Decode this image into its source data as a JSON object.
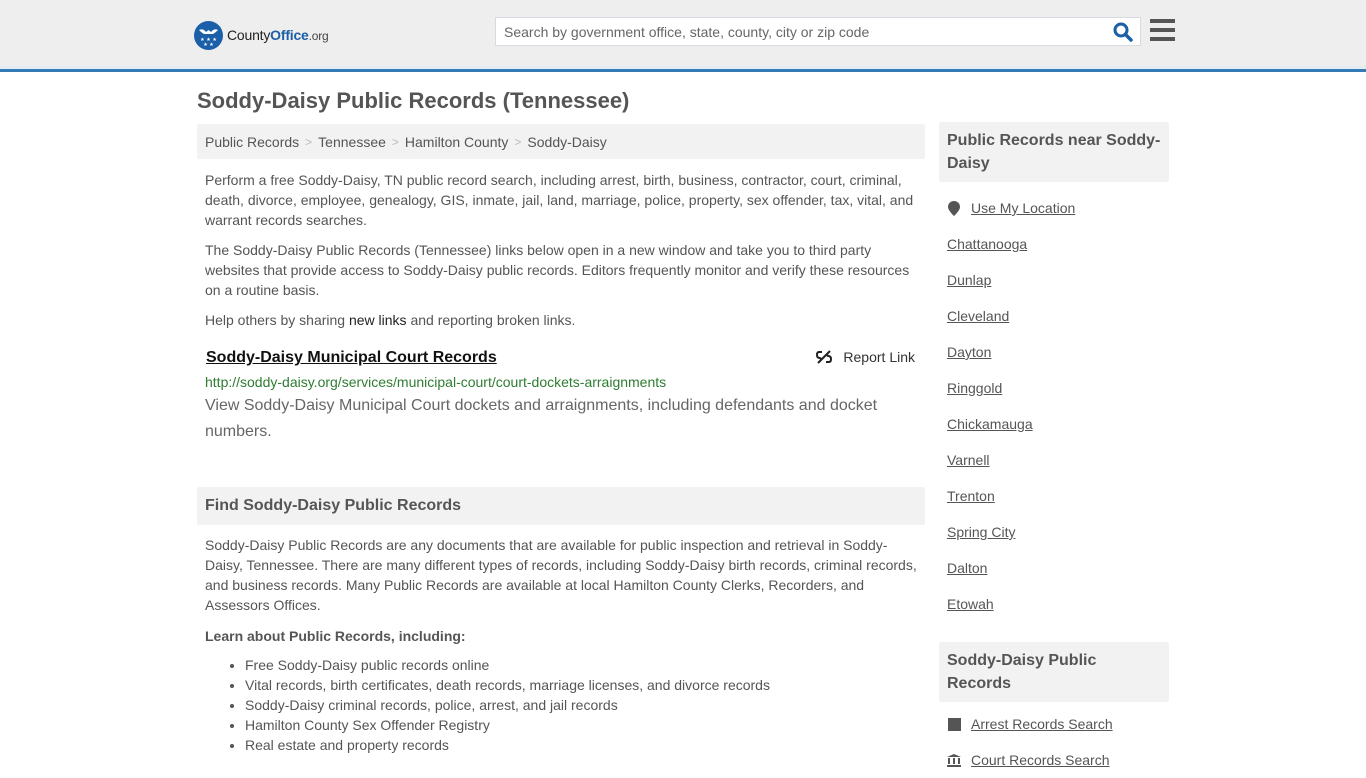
{
  "header": {
    "logo": {
      "name_part1": "County",
      "name_part2": "Office",
      "tld": ".org"
    },
    "search": {
      "placeholder": "Search by government office, state, county, city or zip code",
      "value": ""
    },
    "search_icon": "search-icon",
    "menu_icon": "hamburger-menu-icon"
  },
  "page": {
    "title": "Soddy-Daisy Public Records (Tennessee)",
    "breadcrumb": [
      "Public Records",
      "Tennessee",
      "Hamilton County",
      "Soddy-Daisy"
    ],
    "intro": [
      "Perform a free Soddy-Daisy, TN public record search, including arrest, birth, business, contractor, court, criminal, death, divorce, employee, genealogy, GIS, inmate, jail, land, marriage, police, property, sex offender, tax, vital, and warrant records searches.",
      "The Soddy-Daisy Public Records (Tennessee) links below open in a new window and take you to third party websites that provide access to Soddy-Daisy public records. Editors frequently monitor and verify these resources on a routine basis."
    ],
    "help": {
      "before": "Help others by sharing ",
      "link": "new links",
      "after": " and reporting broken links."
    },
    "listing": {
      "title": "Soddy-Daisy Municipal Court Records",
      "report_label": "Report Link",
      "url": "http://soddy-daisy.org/services/municipal-court/court-dockets-arraignments",
      "description": "View Soddy-Daisy Municipal Court dockets and arraignments, including defendants and docket numbers."
    },
    "find_section": {
      "heading": "Find Soddy-Daisy Public Records",
      "body": "Soddy-Daisy Public Records are any documents that are available for public inspection and retrieval in Soddy-Daisy, Tennessee. There are many different types of records, including Soddy-Daisy birth records, criminal records, and business records. Many Public Records are available at local Hamilton County Clerks, Recorders, and Assessors Offices.",
      "subheading": "Learn about Public Records, including:",
      "bullets": [
        "Free Soddy-Daisy public records online",
        "Vital records, birth certificates, death records, marriage licenses, and divorce records",
        "Soddy-Daisy criminal records, police, arrest, and jail records",
        "Hamilton County Sex Offender Registry",
        "Real estate and property records"
      ]
    }
  },
  "sidebar": {
    "nearby": {
      "heading": "Public Records near Soddy-Daisy",
      "use_location": "Use My Location",
      "cities": [
        "Chattanooga",
        "Dunlap",
        "Cleveland",
        "Dayton",
        "Ringgold",
        "Chickamauga",
        "Varnell",
        "Trenton",
        "Spring City",
        "Dalton",
        "Etowah"
      ]
    },
    "records": {
      "heading": "Soddy-Daisy Public Records",
      "items": [
        {
          "label": "Arrest Records Search",
          "icon": "square-icon"
        },
        {
          "label": "Court Records Search",
          "icon": "courthouse-icon"
        }
      ]
    }
  },
  "colors": {
    "brand": "#1b5fa8",
    "accent_border": "#337ab7",
    "url_green": "#2e7d32"
  }
}
